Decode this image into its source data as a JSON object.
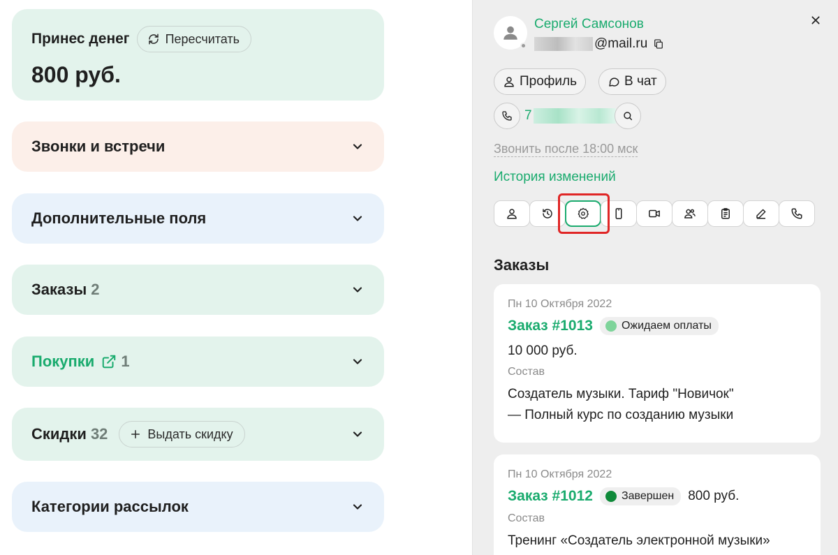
{
  "left": {
    "money": {
      "title": "Принес денег",
      "recalc_label": "Пересчитать",
      "value": "800 руб."
    },
    "sections": {
      "calls": {
        "title": "Звонки и встречи"
      },
      "fields": {
        "title": "Дополнительные поля"
      },
      "orders": {
        "title": "Заказы",
        "count": "2"
      },
      "purchases": {
        "title": "Покупки",
        "count": "1"
      },
      "discounts": {
        "title": "Скидки",
        "count": "32",
        "action": "Выдать скидку"
      },
      "mailing": {
        "title": "Категории рассылок"
      }
    }
  },
  "right": {
    "user": {
      "name": "Сергей Самсонов",
      "email_suffix": "@mail.ru"
    },
    "buttons": {
      "profile": "Профиль",
      "chat": "В чат"
    },
    "phone_prefix": "7",
    "call_after": "Звонить после 18:00 мск",
    "history": "История изменений",
    "toolbar_icons": [
      "user-icon",
      "history-icon",
      "badge-settings-icon",
      "mobile-icon",
      "video-icon",
      "group-icon",
      "clipboard-icon",
      "pencil-icon",
      "phone-icon"
    ],
    "orders_title": "Заказы",
    "orders": [
      {
        "date": "Пн 10 Октября 2022",
        "title": "Заказ #1013",
        "status": "Ожидаем оплаты",
        "status_color": "#7ed49a",
        "price": "10 000 руб.",
        "composition_label": "Состав",
        "composition_line1": "Создатель музыки. Тариф \"Новичок\"",
        "composition_line2": "— Полный курс по созданию музыки"
      },
      {
        "date": "Пн 10 Октября 2022",
        "title": "Заказ #1012",
        "status": "Завершен",
        "status_color": "#0f8a3a",
        "price": "800 руб.",
        "composition_label": "Состав",
        "composition_line1": "Тренинг «Создатель электронной музыки»"
      }
    ]
  },
  "colors": {
    "accent_green": "#1aab6e",
    "highlight_red": "#e02626"
  }
}
